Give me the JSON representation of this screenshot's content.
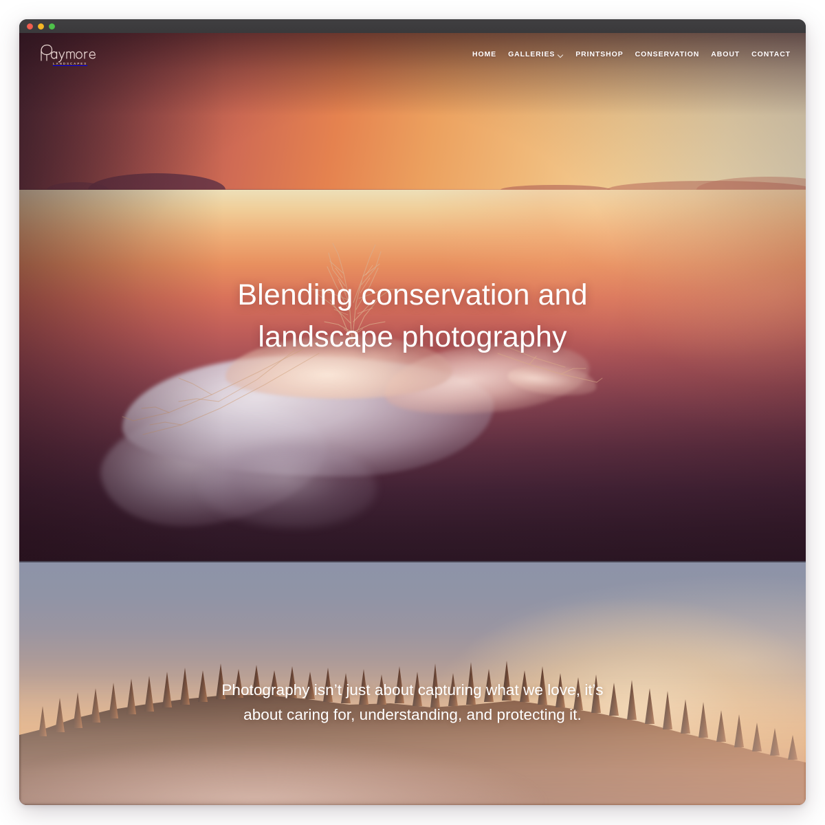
{
  "window": {
    "traffic_lights": [
      {
        "name": "close",
        "color": "#f05e50"
      },
      {
        "name": "minimize",
        "color": "#f5b726"
      },
      {
        "name": "maximize",
        "color": "#4fc14b"
      }
    ]
  },
  "header": {
    "logo": {
      "wordmark": "haymore",
      "subtitle": "LANDSCAPES"
    },
    "nav": [
      {
        "label": "HOME",
        "has_dropdown": false
      },
      {
        "label": "GALLERIES",
        "has_dropdown": true,
        "icon": "chevron-down-icon"
      },
      {
        "label": "PRINTSHOP",
        "has_dropdown": false
      },
      {
        "label": "CONSERVATION",
        "has_dropdown": false
      },
      {
        "label": "ABOUT",
        "has_dropdown": false
      },
      {
        "label": "CONTACT",
        "has_dropdown": false
      }
    ]
  },
  "hero": {
    "headline_line1": "Blending conservation and",
    "headline_line2": "landscape photography",
    "image_description": "Sunset over a calm lake with a frozen ice formation and bare twigs in the foreground, distant hills on the horizon",
    "colors": {
      "sky_left": "#57313d",
      "sky_right": "#eee2c2",
      "water_top": "#eddfb8",
      "water_bottom": "#2d1826",
      "text": "#ffffff"
    }
  },
  "forest_section": {
    "quote_line1": "Photography isn’t just about capturing what we love, it’s",
    "quote_line2": "about caring for, understanding, and protecting it.",
    "image_description": "Misty conifer forest silhouetted against a sunrise sky with golden fog",
    "colors": {
      "sky_top": "#8d93a8",
      "sky_bottom": "#cf9066",
      "text": "#ffffff"
    }
  }
}
